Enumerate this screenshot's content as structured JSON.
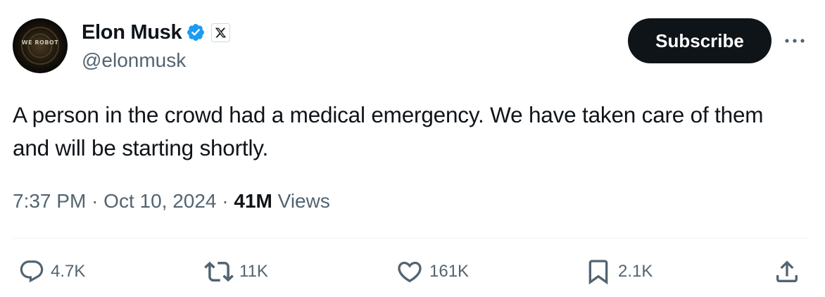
{
  "author": {
    "display_name": "Elon Musk",
    "handle": "@elonmusk",
    "avatar_text": "WE ROBOT",
    "verified_icon": "verified-badge-icon",
    "affiliate_icon": "x-logo-icon"
  },
  "header": {
    "subscribe_label": "Subscribe",
    "more_icon": "more-options-icon"
  },
  "tweet": {
    "text": "A person in the crowd had a medical emergency. We have taken care of them and will be starting shortly."
  },
  "meta": {
    "time": "7:37 PM",
    "separator": "·",
    "date": "Oct 10, 2024",
    "views_count": "41M",
    "views_label": "Views"
  },
  "actions": {
    "replies": "4.7K",
    "reposts": "11K",
    "likes": "161K",
    "bookmarks": "2.1K"
  },
  "colors": {
    "text_primary": "#0f1419",
    "text_secondary": "#536471",
    "verified_blue": "#1d9bf0",
    "button_bg": "#0f1419",
    "divider": "#eff3f4"
  }
}
